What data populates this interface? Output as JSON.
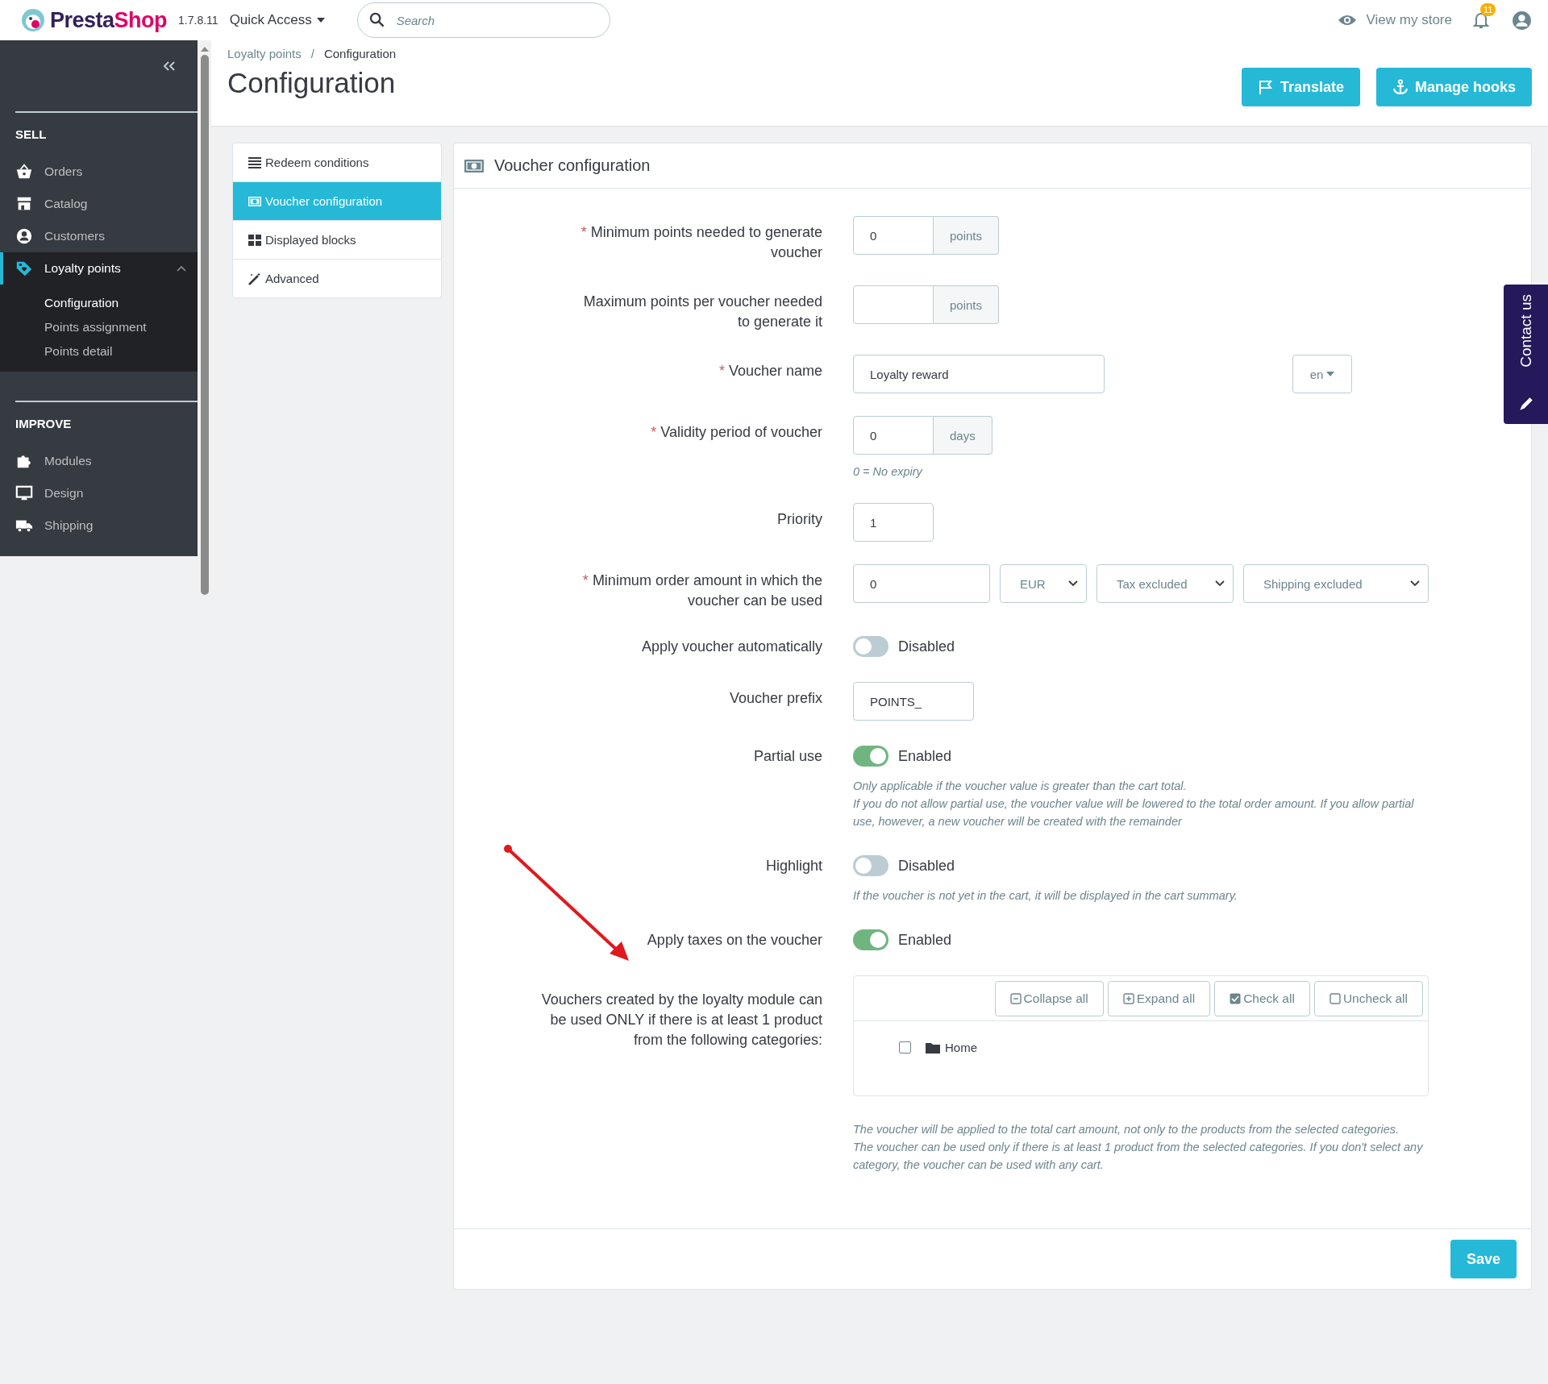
{
  "header": {
    "logo_part_1": "Presta",
    "logo_part_2": "Shop",
    "version": "1.7.8.11",
    "quick_access": "Quick Access",
    "search": {
      "placeholder": "Search"
    },
    "view_store": "View my store",
    "notifications": "11"
  },
  "sidebar": {
    "sections": [
      {
        "title": "SELL",
        "items": [
          {
            "label": "Orders",
            "selected": false
          },
          {
            "label": "Catalog",
            "selected": false
          },
          {
            "label": "Customers",
            "selected": false
          },
          {
            "label": "Loyalty points",
            "selected": true,
            "expanded": true,
            "children": [
              {
                "label": "Configuration",
                "selected": true
              },
              {
                "label": "Points assignment",
                "selected": false
              },
              {
                "label": "Points detail",
                "selected": false
              }
            ]
          }
        ]
      },
      {
        "title": "IMPROVE",
        "items": [
          {
            "label": "Modules",
            "selected": false
          },
          {
            "label": "Design",
            "selected": false
          },
          {
            "label": "Shipping",
            "selected": false
          }
        ]
      }
    ]
  },
  "breadcrumb": [
    "Loyalty points",
    "Configuration"
  ],
  "breadcrumb_separator": "/",
  "page_title": "Configuration",
  "toolbar_buttons": [
    "Translate",
    "Manage hooks"
  ],
  "tabs": [
    {
      "label": "Redeem conditions",
      "selected": false
    },
    {
      "label": "Voucher configuration",
      "selected": true
    },
    {
      "label": "Displayed blocks",
      "selected": false
    },
    {
      "label": "Advanced",
      "selected": false
    }
  ],
  "panel": {
    "title": "Voucher configuration",
    "save": "Save",
    "fields": [
      {
        "kind": "addon",
        "required_mark": "*",
        "label": "Minimum points needed to generate voucher",
        "value": "0",
        "addon": "points"
      },
      {
        "kind": "addon",
        "label": "Maximum points per voucher needed to generate it",
        "addon": "points"
      },
      {
        "kind": "lang",
        "required_mark": "*",
        "label": "Voucher name",
        "value": "Loyalty reward",
        "lang": "en"
      },
      {
        "kind": "addon",
        "required_mark": "*",
        "label": "Validity period of voucher",
        "value": "0",
        "addon": "days",
        "help": [
          "0 = No expiry"
        ]
      },
      {
        "kind": "text",
        "label": "Priority",
        "value": "1"
      },
      {
        "kind": "amount",
        "required_mark": "*",
        "label": "Minimum order amount in which the voucher can be used",
        "value": "0",
        "selects": [
          "EUR",
          "Tax excluded",
          "Shipping excluded"
        ]
      },
      {
        "kind": "switch",
        "label": "Apply voucher automatically",
        "on": false,
        "state": "Disabled"
      },
      {
        "kind": "text",
        "label": "Voucher prefix",
        "value": "POINTS_"
      },
      {
        "kind": "switch",
        "label": "Partial use",
        "on": true,
        "state": "Enabled",
        "help": [
          "Only applicable if the voucher value is greater than the cart total.",
          "If you do not allow partial use, the voucher value will be lowered to the total order amount. If you allow partial use, however, a new voucher will be created with the remainder"
        ]
      },
      {
        "kind": "switch",
        "label": "Highlight",
        "on": false,
        "state": "Disabled",
        "help": [
          "If the voucher is not yet in the cart, it will be displayed in the cart summary."
        ]
      },
      {
        "kind": "switch",
        "label": "Apply taxes on the voucher",
        "on": true,
        "state": "Enabled"
      },
      {
        "kind": "tree",
        "label": "Vouchers created by the loyalty module can be used ONLY if there is at least 1 product from the following categories:",
        "tree_buttons": [
          "Collapse all",
          "Expand all",
          "Check all",
          "Uncheck all"
        ],
        "categories": [
          {
            "label": "Home",
            "checked": false
          }
        ],
        "help": [
          "The voucher will be applied to the total cart amount, not only to the products from the selected categories.",
          "The voucher can be used only if there is at least 1 product from the selected categories. If you don't select any category, the voucher can be used with any cart."
        ]
      }
    ]
  },
  "contact_tab": "Contact us"
}
